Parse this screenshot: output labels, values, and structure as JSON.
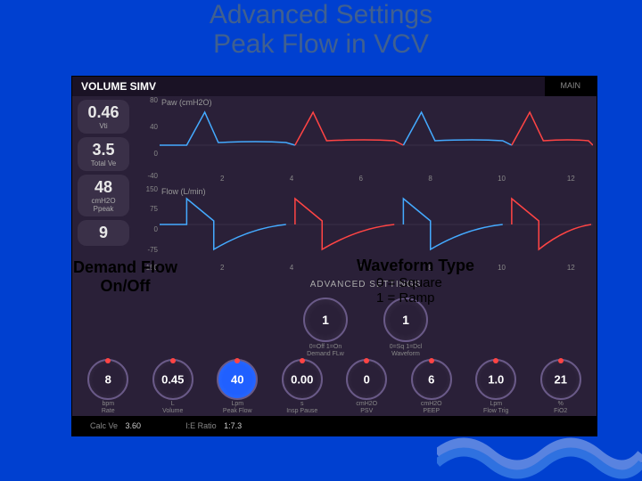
{
  "slide": {
    "title_line1": "Advanced Settings",
    "title_line2": "Peak Flow in VCV"
  },
  "annotations": {
    "demand_flow": "Demand Flow",
    "demand_flow_sub": "On/Off",
    "waveform_type": "Waveform Type",
    "waveform_sub1": "0 = Square",
    "waveform_sub2": "1 = Ramp"
  },
  "topbar": {
    "mode": "VOLUME SIMV",
    "main": "MAIN"
  },
  "measurements": [
    {
      "val": "0.46",
      "unit": "",
      "label": "Vti"
    },
    {
      "val": "3.5",
      "unit": "",
      "label": "Total Ve"
    },
    {
      "val": "48",
      "unit": "cmH2O",
      "label": "Ppeak"
    },
    {
      "val": "9",
      "unit": "",
      "label": ""
    }
  ],
  "waves": {
    "w1": {
      "label": "Paw (cmH2O)",
      "yticks": [
        "80",
        "40",
        "0",
        "-40"
      ],
      "xticks": [
        "2",
        "4",
        "6",
        "8",
        "10",
        "12"
      ]
    },
    "w2": {
      "label": "Flow (L/min)",
      "yticks": [
        "150",
        "75",
        "0",
        "-75",
        "-150"
      ],
      "xticks": [
        "2",
        "4",
        "6",
        "8",
        "10",
        "12"
      ]
    }
  },
  "advanced": {
    "title": "ADVANCED SETTINGS",
    "knobs": [
      {
        "val": "1",
        "label": "0=Off 1=On\nDemand FLw"
      },
      {
        "val": "1",
        "label": "0=Sq 1=Dcl\nWaveform"
      }
    ]
  },
  "bottom_knobs": [
    {
      "val": "8",
      "unit": "bpm",
      "label": "Rate",
      "alert": false
    },
    {
      "val": "0.45",
      "unit": "L",
      "label": "Volume",
      "alert": false
    },
    {
      "val": "40",
      "unit": "Lpm",
      "label": "Peak Flow",
      "alert": true
    },
    {
      "val": "0.00",
      "unit": "s",
      "label": "Insp Pause",
      "alert": false
    },
    {
      "val": "0",
      "unit": "cmH2O",
      "label": "PSV",
      "alert": false
    },
    {
      "val": "6",
      "unit": "cmH2O",
      "label": "PEEP",
      "alert": false
    },
    {
      "val": "1.0",
      "unit": "Lpm",
      "label": "Flow Trig",
      "alert": false
    },
    {
      "val": "21",
      "unit": "%",
      "label": "FiO2",
      "alert": false
    }
  ],
  "footer": [
    {
      "label": "Calc Ve",
      "val": "3.60"
    },
    {
      "label": "I:E Ratio",
      "val": "1:7.3"
    }
  ]
}
